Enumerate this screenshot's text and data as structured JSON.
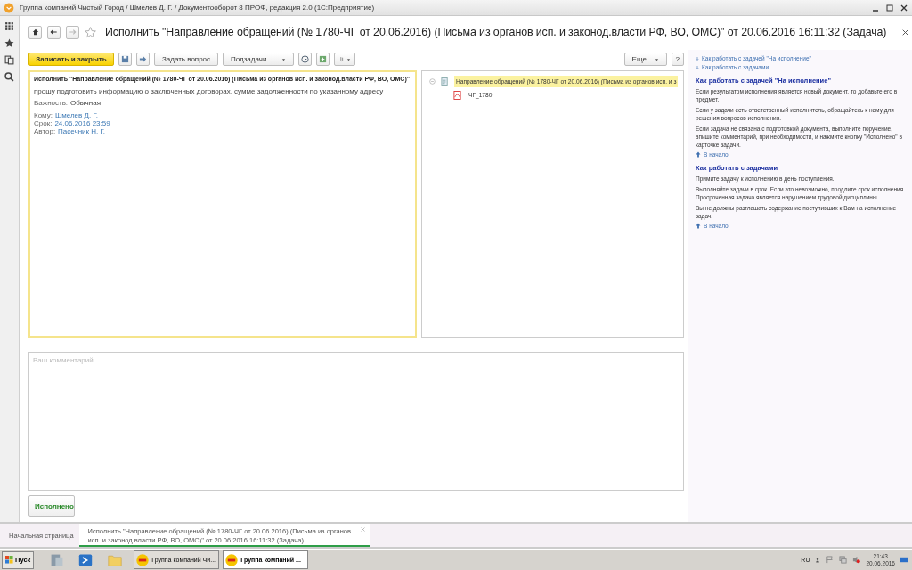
{
  "window": {
    "title": "Группа компаний Чистый Город / Шмелев Д. Г. / Документооборот 8 ПРОФ, редакция 2.0 (1С:Предприятие)"
  },
  "form": {
    "title": "Исполнить \"Направление обращений (№ 1780-ЧГ от 20.06.2016) (Письма из органов исп. и законод.власти РФ, ВО, ОМС)\" от 20.06.2016 16:11:32 (Задача)"
  },
  "toolbar": {
    "primary": "Записать и закрыть",
    "ask": "Задать вопрос",
    "subtasks": "Подзадачи",
    "more": "Еще",
    "help": "?"
  },
  "task": {
    "title": "Исполнить \"Направление обращений (№ 1780-ЧГ от 20.06.2016) (Письма из органов исп. и законод.власти РФ, ВО, ОМС)\"",
    "description": "прошу подготовить информацию о заключенных договорах, сумме задолженности по указанному адресу",
    "importance_label": "Важность:",
    "importance": "Обычная",
    "fields": [
      {
        "label": "Кому:",
        "value": "Шмелев Д. Г."
      },
      {
        "label": "Срок:",
        "value": "24.06.2016 23:59"
      },
      {
        "label": "Автор:",
        "value": "Пасечник Н. Г."
      }
    ]
  },
  "attachments": [
    {
      "label": "Направление обращений (№ 1780-ЧГ от 20.06.2016) (Письма из органов исп. и з",
      "expanded": true,
      "selected": true,
      "kind": "document",
      "children": [
        {
          "label": "ЧГ_1780",
          "selected": false,
          "kind": "pdf"
        }
      ]
    }
  ],
  "comment": {
    "placeholder": "Ваш комментарий"
  },
  "done_button": "Исполнено",
  "help": {
    "links": [
      "Как работать с задачей \"На исполнение\"",
      "Как работать с задачами"
    ],
    "sections": [
      {
        "heading": "Как работать с задачей \"На исполнение\"",
        "paragraphs": [
          "Если результатом исполнения является новый документ, то добавьте его в предмет.",
          "Если у задачи есть ответственный исполнитель, обращайтесь к нему для решения вопросов исполнения.",
          "Если задача не связана с подготовкой документа, выполните поручение, впишите комментарий, при необходимости, и нажмите кнопку \"Исполнено\" в карточке задачи."
        ],
        "top_link": "В начало"
      },
      {
        "heading": "Как работать с задачами",
        "paragraphs": [
          "Примите задачу к исполнению в день поступления.",
          "Выполняйте задачи в срок. Если это невозможно, продлите срок исполнения. Просроченная задача является нарушением трудовой дисциплины.",
          "Вы не должны разглашать содержание поступивших к Вам на исполнение задач."
        ],
        "top_link": "В начало"
      }
    ]
  },
  "tabs": [
    {
      "label": "Начальная страница",
      "selected": false
    },
    {
      "label": "Исполнить \"Направление обращений (№ 1780-ЧГ от 20.06.2016) (Письма из органов исп. и законод.власти РФ, ВО, ОМС)\" от 20.06.2016 16:11:32 (Задача)",
      "selected": true
    }
  ],
  "taskbar": {
    "start": "Пуск",
    "tasks": [
      {
        "label": "Группа компаний Чи...",
        "selected": false
      },
      {
        "label": "Группа компаний ...",
        "selected": true
      }
    ],
    "language": "RU",
    "time": "21:43",
    "date": "20.06.2016"
  }
}
